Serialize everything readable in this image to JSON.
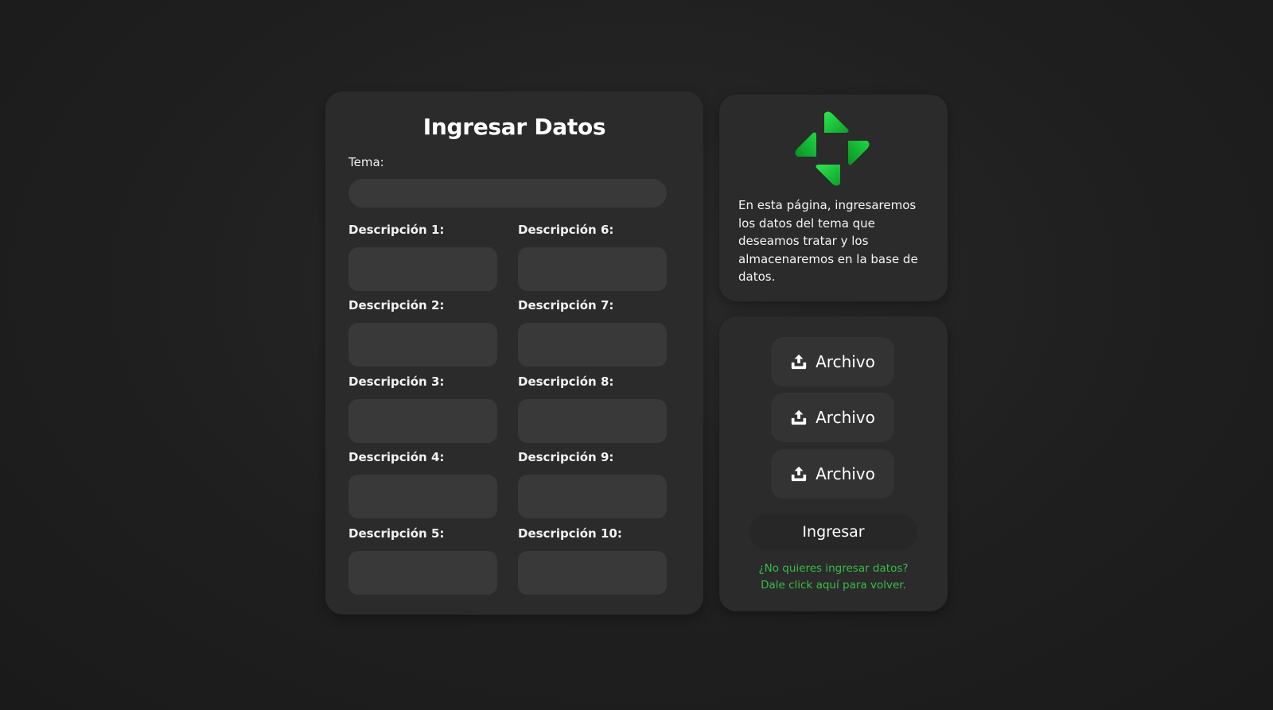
{
  "form": {
    "title": "Ingresar Datos",
    "tema_label": "Tema:",
    "tema_value": "",
    "descriptions": [
      {
        "label": "Descripción 1:",
        "value": ""
      },
      {
        "label": "Descripción 2:",
        "value": ""
      },
      {
        "label": "Descripción 3:",
        "value": ""
      },
      {
        "label": "Descripción 4:",
        "value": ""
      },
      {
        "label": "Descripción 5:",
        "value": ""
      },
      {
        "label": "Descripción 6:",
        "value": ""
      },
      {
        "label": "Descripción 7:",
        "value": ""
      },
      {
        "label": "Descripción 8:",
        "value": ""
      },
      {
        "label": "Descripción 9:",
        "value": ""
      },
      {
        "label": "Descripción 10:",
        "value": ""
      }
    ]
  },
  "info": {
    "logo_icon": "green-diamond-arrows-logo",
    "text": "En esta página, ingresaremos los datos del tema que deseamos tratar y los almacenaremos en la base de datos."
  },
  "actions": {
    "file_buttons": [
      {
        "label": "Archivo",
        "icon": "upload-icon"
      },
      {
        "label": "Archivo",
        "icon": "upload-icon"
      },
      {
        "label": "Archivo",
        "icon": "upload-icon"
      }
    ],
    "submit_label": "Ingresar",
    "back_line1": "¿No quieres ingresar datos?",
    "back_line2": "Dale click aquí para volver."
  },
  "colors": {
    "background": "#1f1f1f",
    "card": "#2b2b2b",
    "field": "#393939",
    "accent_green": "#3cbb49",
    "logo_green": "#1fc33b"
  }
}
